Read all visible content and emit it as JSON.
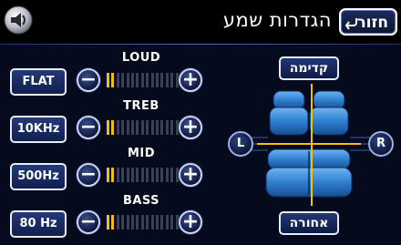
{
  "header": {
    "title": "הגדרות שמע",
    "back_label": "חזור"
  },
  "controls": [
    {
      "key": "loud",
      "label": "LOUD",
      "preset": "FLAT",
      "level": 0.1
    },
    {
      "key": "treb",
      "label": "TREB",
      "preset": "10KHz",
      "level": 0.1
    },
    {
      "key": "mid",
      "label": "MID",
      "preset": "500Hz",
      "level": 0.1
    },
    {
      "key": "bass",
      "label": "BASS",
      "preset": "80 Hz",
      "level": 0.1
    }
  ],
  "balance": {
    "front_label": "קדימה",
    "rear_label": "אחורה",
    "left_label": "L",
    "right_label": "R"
  },
  "icons": {
    "minus": "−",
    "plus": "+"
  },
  "colors": {
    "accent": "#f2c200",
    "button": "#1b2c62",
    "seat": "#2f7fd0"
  }
}
